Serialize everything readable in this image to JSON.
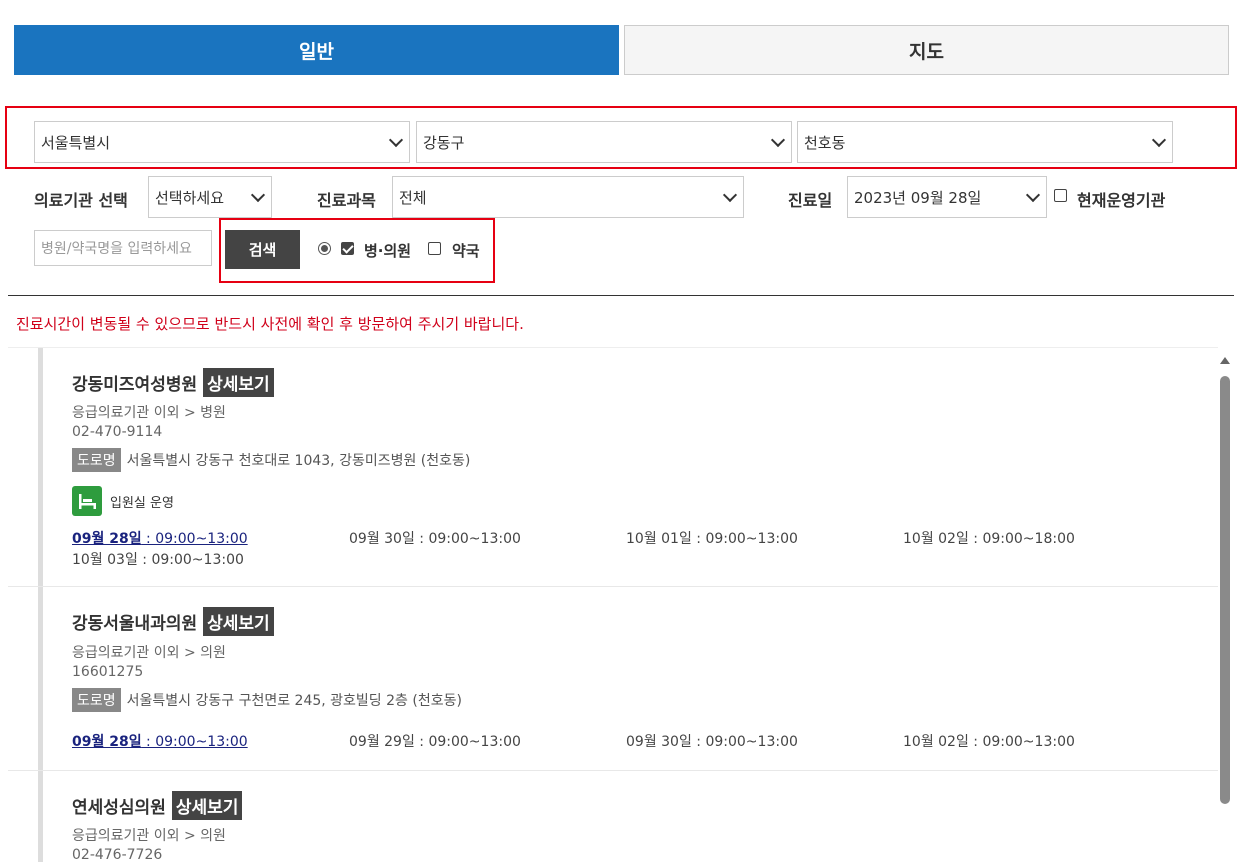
{
  "tabs": {
    "general": "일반",
    "map": "지도"
  },
  "region": {
    "city": "서울특별시",
    "district": "강동구",
    "dong": "천호동"
  },
  "filters": {
    "institution_label": "의료기관 선택",
    "institution_value": "선택하세요",
    "department_label": "진료과목",
    "department_value": "전체",
    "date_label": "진료일",
    "date_value": "2023년 09월 28일",
    "operating_label": "현재운영기관",
    "search_placeholder": "병원/약국명을 입력하세요",
    "search_button": "검색",
    "hospital_label": "병·의원",
    "pharmacy_label": "약국"
  },
  "notice": "진료시간이 변동될 수 있으므로 반드시 사전에 확인 후 방문하여 주시기 바랍니다.",
  "detail_label": "상세보기",
  "road_label": "도로명",
  "bed_label": "입원실 운영",
  "results": [
    {
      "name": "강동미즈여성병원",
      "category": "응급의료기관 이외 > 병원",
      "phone": "02-470-9114",
      "address": "서울특별시 강동구 천호대로 1043, 강동미즈병원 (천호동)",
      "schedule": [
        {
          "day": "09월 28일",
          "time": " : 09:00~13:00"
        },
        {
          "day": "09월 30일",
          "time": " : 09:00~13:00"
        },
        {
          "day": "10월 01일",
          "time": " : 09:00~13:00"
        },
        {
          "day": "10월 02일",
          "time": " : 09:00~18:00"
        },
        {
          "day": "10월 03일",
          "time": " : 09:00~13:00"
        }
      ]
    },
    {
      "name": "강동서울내과의원",
      "category": "응급의료기관 이외 > 의원",
      "phone": "16601275",
      "address": "서울특별시 강동구 구천면로 245, 광호빌딩 2층 (천호동)",
      "schedule": [
        {
          "day": "09월 28일",
          "time": " : 09:00~13:00"
        },
        {
          "day": "09월 29일",
          "time": " : 09:00~13:00"
        },
        {
          "day": "09월 30일",
          "time": " : 09:00~13:00"
        },
        {
          "day": "10월 02일",
          "time": " : 09:00~13:00"
        }
      ]
    },
    {
      "name": "연세성심의원",
      "category": "응급의료기관 이외 > 의원",
      "phone": "02-476-7726"
    }
  ],
  "colors": {
    "accent": "#1a74bf",
    "highlight": "#e60012",
    "notice": "#d0021b",
    "bed_icon": "#2e9c3e"
  }
}
